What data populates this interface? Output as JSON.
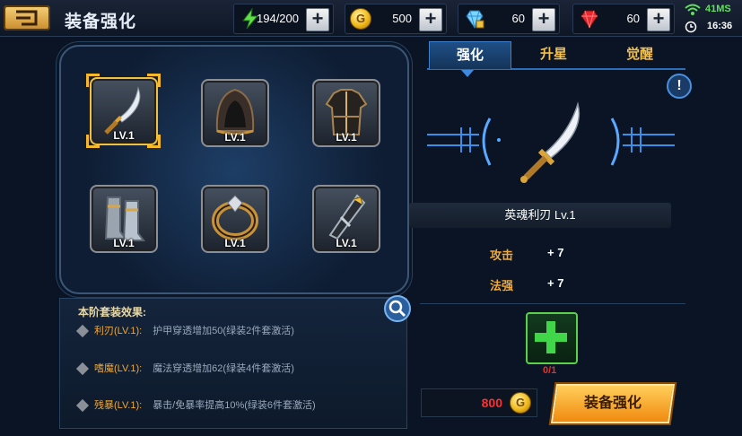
{
  "header": {
    "title": "装备强化",
    "stamina": "194/200",
    "gold": "500",
    "diamond": "60",
    "ruby": "60",
    "ping": "41MS",
    "clock": "16:36"
  },
  "slots": [
    {
      "level": "LV.1"
    },
    {
      "level": "LV.1"
    },
    {
      "level": "LV.1"
    },
    {
      "level": "LV.1"
    },
    {
      "level": "LV.1"
    },
    {
      "level": "LV.1"
    }
  ],
  "set_bonus": {
    "title": "本阶套装效果:",
    "rows": [
      {
        "name": "利刃(LV.1):",
        "desc": "护甲穿透增加50(绿装2件套激活)"
      },
      {
        "name": "嗜魔(LV.1):",
        "desc": "魔法穿透增加62(绿装4件套激活)"
      },
      {
        "name": "残暴(LV.1):",
        "desc": "暴击/免暴率提高10%(绿装6件套激活)"
      }
    ]
  },
  "tabs": [
    "强化",
    "升星",
    "觉醒"
  ],
  "item": {
    "name": "英魂利刃 Lv.1",
    "stats": [
      {
        "label": "攻击",
        "value": "+ 7"
      },
      {
        "label": "法强",
        "value": "+ 7"
      }
    ]
  },
  "material_count": "0/1",
  "cost": "800",
  "coin_symbol": "G",
  "enhance_button": "装备强化",
  "info_symbol": "!"
}
